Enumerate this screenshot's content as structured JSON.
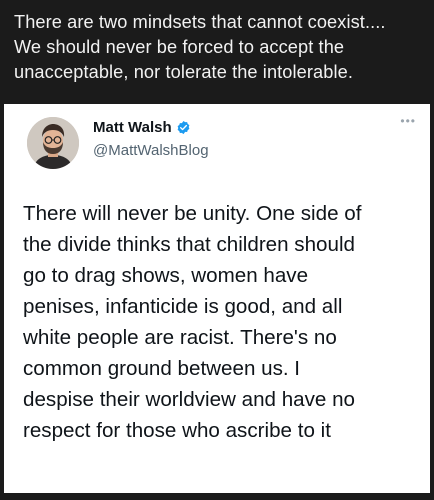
{
  "caption": {
    "lines": [
      "There are two mindsets that cannot coexist....",
      "We should never be forced to accept the",
      "unacceptable, nor tolerate the intolerable."
    ]
  },
  "tweet": {
    "display_name": "Matt Walsh",
    "handle": "@MattWalshBlog",
    "verified_icon": "verified-badge-icon",
    "more_icon": "more-options-icon",
    "verified_color": "#1d9bf0",
    "body_lines": [
      "There will never be unity. One side of",
      "the divide thinks that children should",
      "go to drag shows, women have",
      "penises, infanticide is good, and all",
      "white people are racist. There's no",
      "common ground between us. I",
      "despise their worldview and have no",
      "respect for those who ascribe to it"
    ]
  }
}
